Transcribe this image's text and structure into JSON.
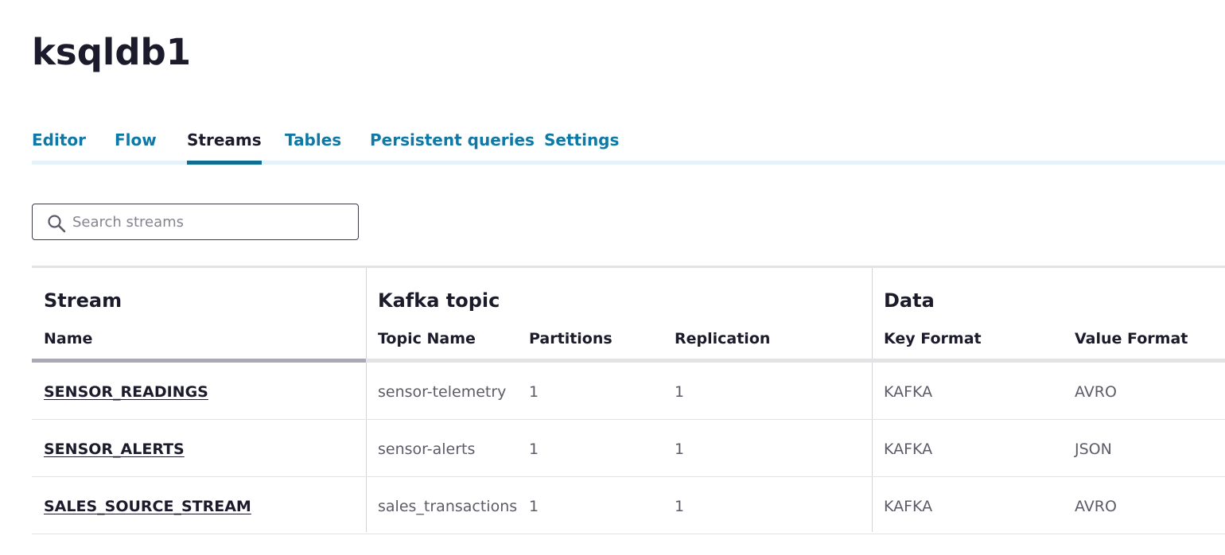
{
  "header": {
    "title": "ksqldb1"
  },
  "tabs": [
    {
      "label": "Editor",
      "active": false
    },
    {
      "label": "Flow",
      "active": false
    },
    {
      "label": "Streams",
      "active": true
    },
    {
      "label": "Tables",
      "active": false
    },
    {
      "label": "Persistent queries",
      "active": false
    },
    {
      "label": "Settings",
      "active": false
    }
  ],
  "search": {
    "placeholder": "Search streams",
    "value": "",
    "icon": "search-icon"
  },
  "table": {
    "groups": [
      "Stream",
      "Kafka topic",
      "Data"
    ],
    "columns": [
      "Name",
      "Topic Name",
      "Partitions",
      "Replication",
      "Key Format",
      "Value Format"
    ],
    "rows": [
      {
        "name": "SENSOR_READINGS",
        "topic": "sensor-telemetry",
        "partitions": "1",
        "replication": "1",
        "key_format": "KAFKA",
        "value_format": "AVRO"
      },
      {
        "name": "SENSOR_ALERTS",
        "topic": "sensor-alerts",
        "partitions": "1",
        "replication": "1",
        "key_format": "KAFKA",
        "value_format": "JSON"
      },
      {
        "name": "SALES_SOURCE_STREAM",
        "topic": "sales_transactions",
        "partitions": "1",
        "replication": "1",
        "key_format": "KAFKA",
        "value_format": "AVRO"
      }
    ]
  },
  "colors": {
    "tab_link": "#0e79a6",
    "tab_indicator": "#0e6e91",
    "text": "#1b1b2c",
    "muted": "#5c5c69"
  }
}
